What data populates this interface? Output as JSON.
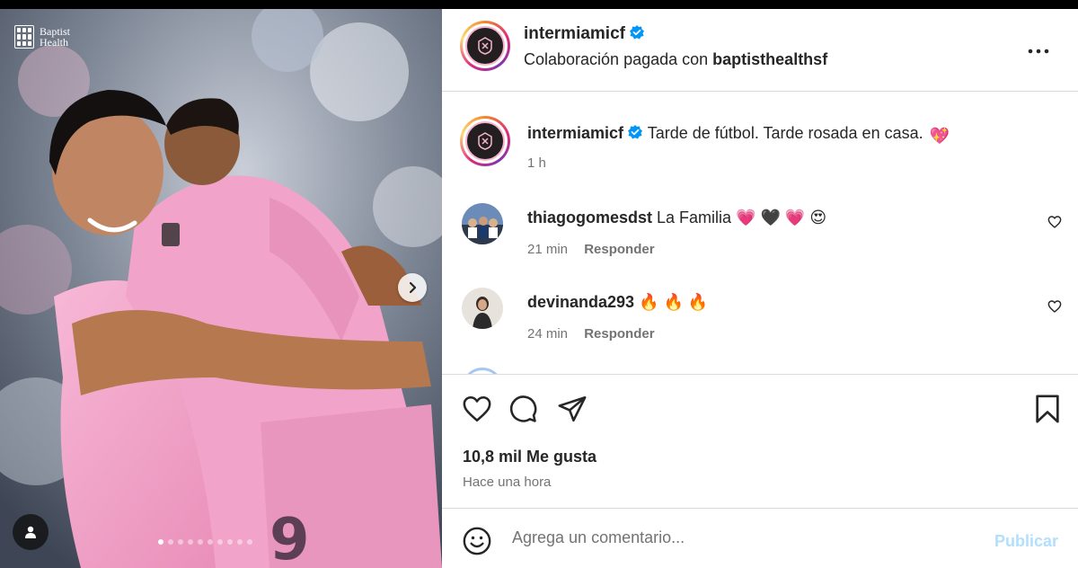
{
  "media": {
    "sponsor_logo_text": "Baptist Health",
    "carousel": {
      "total_slides": 10,
      "active_index": 0
    }
  },
  "header": {
    "username": "intermiamicf",
    "partnership_prefix": "Colaboración pagada con",
    "partner": "baptisthealthsf",
    "more_icon": "more-horizontal-icon"
  },
  "caption": {
    "username": "intermiamicf",
    "text": "Tarde de fútbol. Tarde rosada en casa.",
    "emoji": "💖",
    "time": "1 h"
  },
  "comments": [
    {
      "username": "thiagogomesdst",
      "text": "La Familia",
      "emojis": "💗 🖤 💗 😍",
      "time": "21 min",
      "reply": "Responder"
    },
    {
      "username": "devinanda293",
      "text": "",
      "emojis": "🔥 🔥 🔥",
      "time": "24 min",
      "reply": "Responder"
    }
  ],
  "actions": {
    "likes": "10,8 mil Me gusta",
    "time": "Hace una hora"
  },
  "add_comment": {
    "placeholder": "Agrega un comentario...",
    "publish": "Publicar"
  },
  "colors": {
    "verified": "#0095f6",
    "publish_disabled": "#b2dffc",
    "secondary_text": "#737373",
    "jersey_pink": "#f3a3c8"
  }
}
